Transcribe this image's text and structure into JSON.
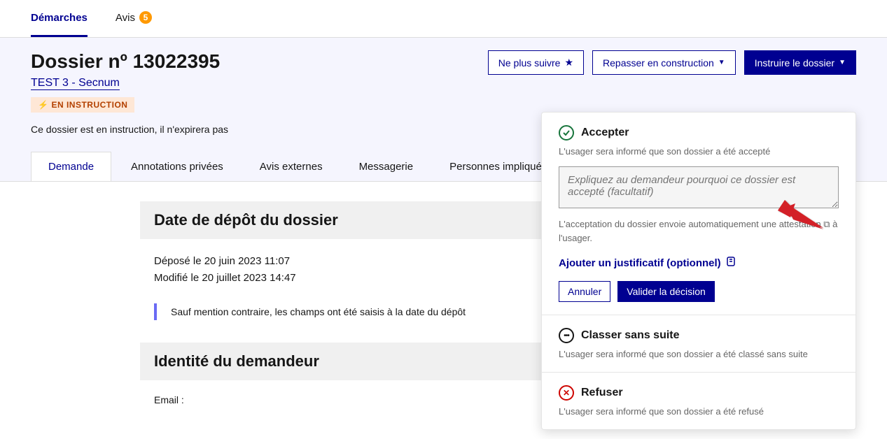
{
  "nav": {
    "demarches": "Démarches",
    "avis": "Avis",
    "avis_count": "5"
  },
  "header": {
    "title": "Dossier nº 13022395",
    "procedure": "TEST 3 - Secnum",
    "status": "EN INSTRUCTION",
    "meta": "Ce dossier est en instruction, il n'expirera pas"
  },
  "actions": {
    "unfollow": "Ne plus suivre",
    "repasser": "Repasser en construction",
    "instruire": "Instruire le dossier"
  },
  "tabs": {
    "demande": "Demande",
    "annotations": "Annotations privées",
    "avis_ext": "Avis externes",
    "messagerie": "Messagerie",
    "personnes": "Personnes impliquées"
  },
  "content": {
    "date_section": "Date de dépôt du dossier",
    "depose": "Déposé le 20 juin 2023 11:07",
    "modifie": "Modifié le 20 juillet 2023 14:47",
    "notice": "Sauf mention contraire, les champs ont été saisis à la date du dépôt",
    "identite_section": "Identité du demandeur",
    "email_label": "Email :"
  },
  "popover": {
    "accepter": {
      "title": "Accepter",
      "desc": "L'usager sera informé que son dossier a été accepté",
      "textarea_placeholder": "Expliquez au demandeur pourquoi ce dossier est accepté (facultatif)",
      "info": "L'acceptation du dossier envoie automatiquement une attestation ⧉ à l'usager.",
      "attachment": "Ajouter un justificatif (optionnel)",
      "cancel": "Annuler",
      "validate": "Valider la décision"
    },
    "classer": {
      "title": "Classer sans suite",
      "desc": "L'usager sera informé que son dossier a été classé sans suite"
    },
    "refuser": {
      "title": "Refuser",
      "desc": "L'usager sera informé que son dossier a été refusé"
    }
  }
}
